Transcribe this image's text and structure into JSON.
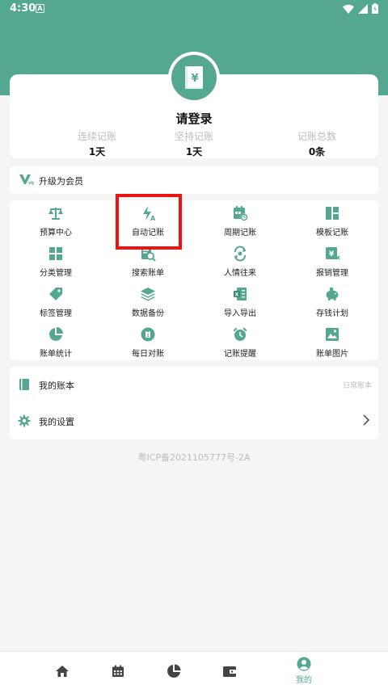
{
  "status_bar": {
    "time": "4:30",
    "a_badge": "A"
  },
  "profile": {
    "login_text": "请登录",
    "avatar_symbol": "¥",
    "stats": [
      {
        "label": "连续记账",
        "value": "1天"
      },
      {
        "label": "坚持记账",
        "value": "1天"
      },
      {
        "label": "记账总数",
        "value": "0条"
      }
    ]
  },
  "vip": {
    "label": "升级为会员"
  },
  "features": [
    {
      "label": "预算中心",
      "icon": "scale-icon"
    },
    {
      "label": "自动记账",
      "icon": "lightning-a-icon"
    },
    {
      "label": "周期记账",
      "icon": "calendar-clock-icon"
    },
    {
      "label": "模板记账",
      "icon": "template-grid-icon"
    },
    {
      "label": "分类管理",
      "icon": "category-grid-icon"
    },
    {
      "label": "搜索账单",
      "icon": "search-bill-icon"
    },
    {
      "label": "人情往来",
      "icon": "exchange-icon"
    },
    {
      "label": "报销管理",
      "icon": "reimburse-icon"
    },
    {
      "label": "标签管理",
      "icon": "tag-icon"
    },
    {
      "label": "数据备份",
      "icon": "layers-icon"
    },
    {
      "label": "导入导出",
      "icon": "excel-import-icon"
    },
    {
      "label": "存钱计划",
      "icon": "piggy-bank-icon"
    },
    {
      "label": "账单统计",
      "icon": "pie-chart-icon"
    },
    {
      "label": "每日对账",
      "icon": "daily-check-icon"
    },
    {
      "label": "记账提醒",
      "icon": "alarm-clock-icon"
    },
    {
      "label": "账单图片",
      "icon": "image-icon"
    }
  ],
  "book": {
    "label": "我的账本",
    "value": "日常账本"
  },
  "settings": {
    "label": "我的设置"
  },
  "icp": "粤ICP备2021105777号-2A",
  "bottom_nav": {
    "active_label": "我的"
  },
  "colors": {
    "accent": "#54a891",
    "highlight": "#ee1111"
  }
}
